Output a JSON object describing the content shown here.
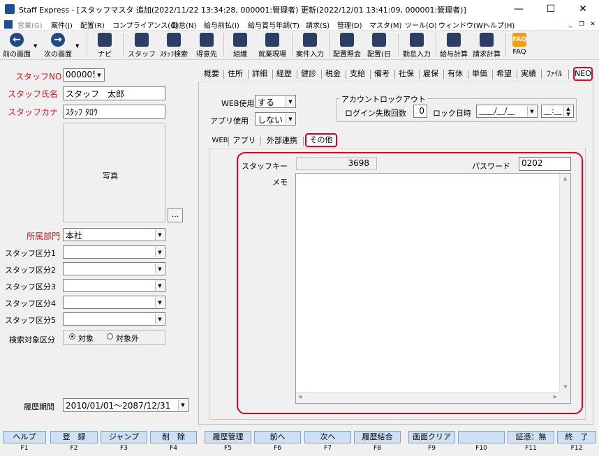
{
  "window": {
    "title": "Staff Express - [スタッフマスタ 追加(2022/11/22 13:34:28, 000001:管理者) 更新(2022/12/01 13:41:09, 000001:管理者)]",
    "minimize": "—",
    "maximize": "☐",
    "close": "✕"
  },
  "menu": {
    "items": [
      "営業(G)",
      "案件(J)",
      "配置(R)",
      "コンプライアンス(C)",
      "勤怠(N)",
      "給与前払(I)",
      "給与賞与年調(T)",
      "請求(S)",
      "管理(D)",
      "マスタ(M)",
      "ツール(O)",
      "ウィンドウ(W)",
      "ヘルプ(H)"
    ],
    "mdi_min": "_",
    "mdi_restore": "❐",
    "mdi_close": "✕"
  },
  "toolbar": {
    "prev_label": "前の画面",
    "next_label": "次の画面",
    "navi_label": "ナビ",
    "staff_label": "スタッフ",
    "staff_search_label": "ｽﾀｯﾌ検索",
    "client_label": "得意先",
    "org_label": "組織",
    "worksite_label": "就業現場",
    "case_input_label": "案件入力",
    "placement_query_label": "配置照会",
    "placement_day_label": "配置(日",
    "attendance_input_label": "勤怠入力",
    "payroll_calc_label": "給与計算",
    "billing_calc_label": "請求計算",
    "faq_label": "FAQ",
    "faq_icon_text": "FAQ"
  },
  "left": {
    "staff_no_label": "スタッフNO",
    "staff_no_value": "000005",
    "staff_name_label": "スタッフ氏名",
    "staff_name_value": "スタッフ　太郎",
    "staff_kana_label": "スタッフカナ",
    "staff_kana_value": "ｽﾀｯﾌ ﾀﾛｳ",
    "photo_label": "写真",
    "photo_browse": "...",
    "dept_label": "所属部門",
    "dept_value": "本社",
    "class1_label": "スタッフ区分1",
    "class2_label": "スタッフ区分2",
    "class3_label": "スタッフ区分3",
    "class4_label": "スタッフ区分4",
    "class5_label": "スタッフ区分5",
    "search_target_label": "検索対象区分",
    "search_target_option1": "対象",
    "search_target_option2": "対象外",
    "history_label": "履歴期間",
    "history_value": "2010/01/01～2087/12/31"
  },
  "main_tabs": [
    "概要",
    "住所",
    "詳細",
    "経歴",
    "健診",
    "税金",
    "支給",
    "備考",
    "社保",
    "雇保",
    "有休",
    "単価",
    "希望",
    "実績",
    "ﾌｧｲﾙ",
    "NEO"
  ],
  "neo": {
    "web_use_label": "WEB使用",
    "web_use_value": "する",
    "app_use_label": "アプリ使用",
    "app_use_value": "しない",
    "lockout_title": "アカウントロックアウト",
    "login_fail_label": "ログイン失敗回数",
    "login_fail_value": "0",
    "lock_date_label": "ロック日時",
    "lock_date_value": "____/__/__",
    "lock_time_value": "__:__",
    "sub_tabs": [
      "WEB",
      "アプリ",
      "外部連携",
      "その他"
    ],
    "staff_key_label": "スタッフキー",
    "staff_key_value": "3698",
    "password_label": "パスワード",
    "password_value": "0202",
    "memo_label": "メモ",
    "memo_value": ""
  },
  "fkeys": [
    {
      "label": "ヘルプ",
      "key": "F1"
    },
    {
      "label": "登　録",
      "key": "F2"
    },
    {
      "label": "ジャンプ",
      "key": "F3"
    },
    {
      "label": "削　除",
      "key": "F4"
    },
    {
      "label": "履歴管理",
      "key": "F5"
    },
    {
      "label": "前へ",
      "key": "F6"
    },
    {
      "label": "次へ",
      "key": "F7"
    },
    {
      "label": "履歴結合",
      "key": "F8"
    },
    {
      "label": "画面クリア",
      "key": "F9"
    },
    {
      "label": "",
      "key": "F10"
    },
    {
      "label": "証憑：無",
      "key": "F11"
    },
    {
      "label": "終　了",
      "key": "F12"
    }
  ],
  "colors": {
    "accent_red": "#e3001b",
    "label_red": "#d0161a",
    "fkey_bg": "#cfe0f3"
  }
}
